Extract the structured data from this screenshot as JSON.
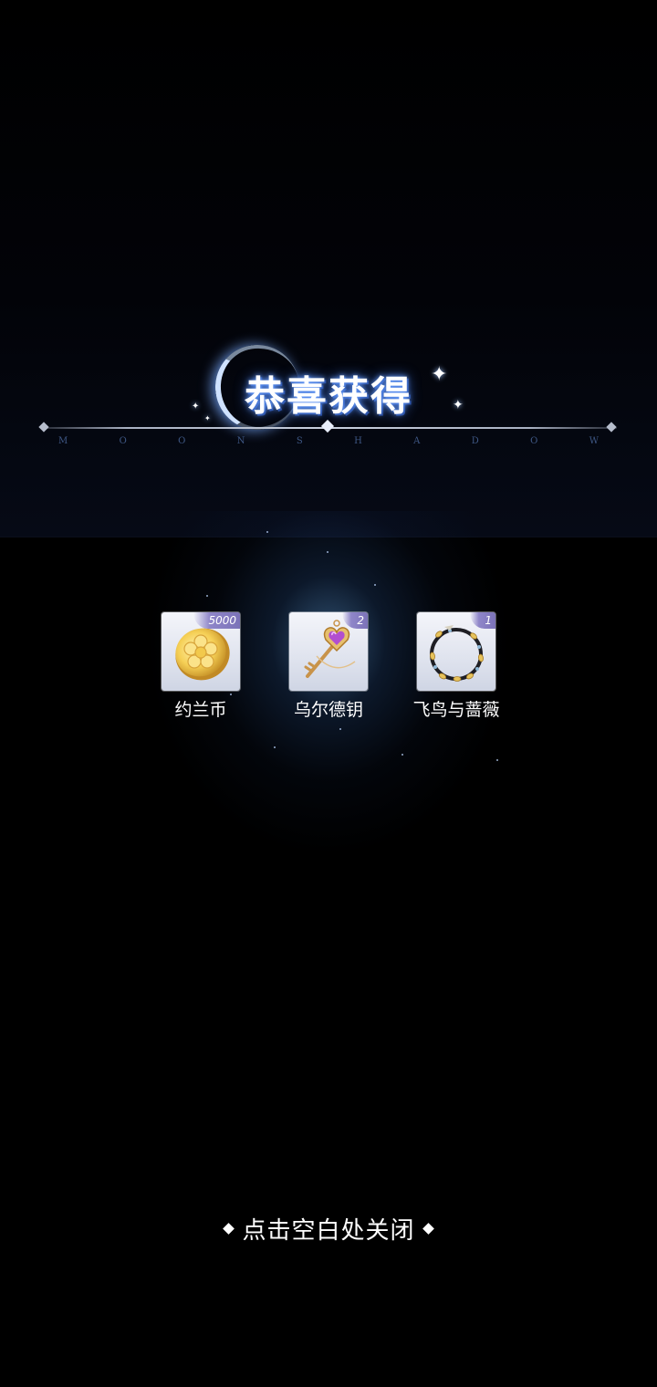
{
  "popup": {
    "title": "恭喜获得",
    "subtitle_letters": [
      "M",
      "O",
      "O",
      "N",
      "S",
      "H",
      "A",
      "D",
      "O",
      "W"
    ],
    "close_hint": "点击空白处关闭"
  },
  "rewards": [
    {
      "name": "约兰币",
      "count": "5000",
      "icon": "gold-coin-icon"
    },
    {
      "name": "乌尔德钥",
      "count": "2",
      "icon": "heart-key-icon"
    },
    {
      "name": "飞鸟与蔷薇",
      "count": "1",
      "icon": "floral-wreath-icon"
    }
  ],
  "colors": {
    "background": "#000000",
    "title_glow": "#6aa0ff",
    "badge": "#7b72b8",
    "card": "#e4e8f1"
  }
}
